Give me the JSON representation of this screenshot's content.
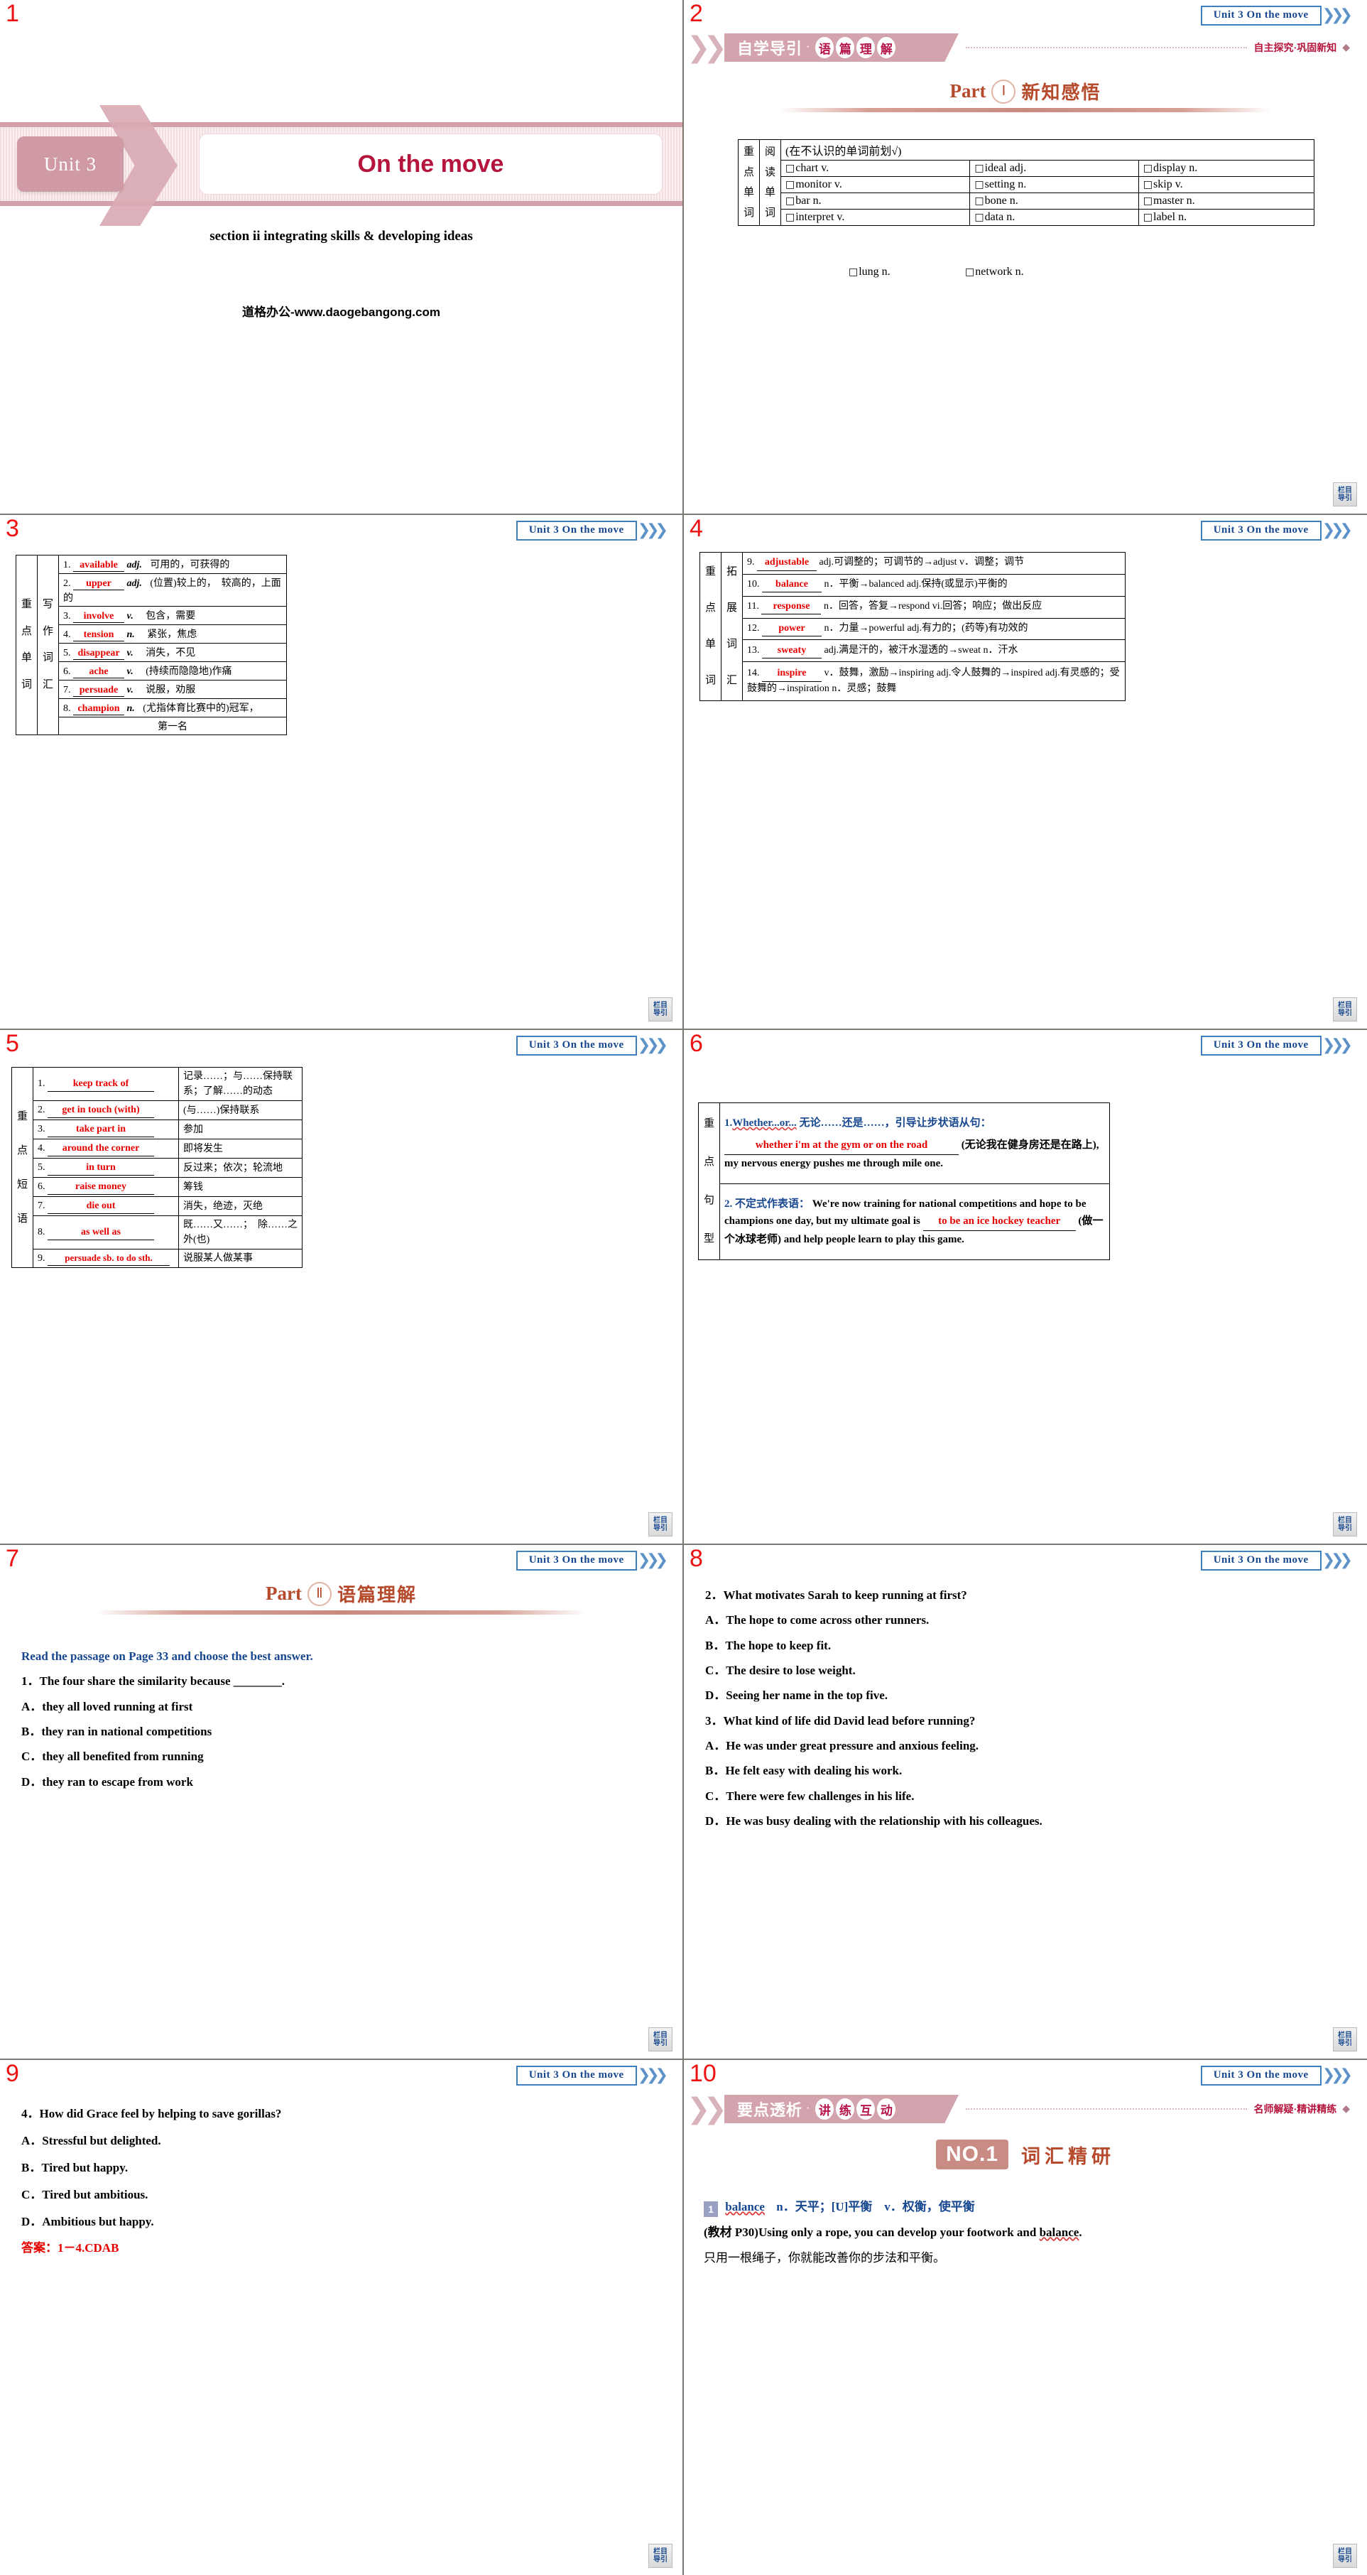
{
  "common": {
    "unit_banner": "Unit 3   On the move",
    "nav_button_line1": "栏目",
    "nav_button_line2": "导引",
    "accent_red": "#e60000",
    "accent_blue": "#16478f",
    "accent_brown": "#b64a2c",
    "accent_pink": "#d3a4ad"
  },
  "slides": [
    {
      "num": "1"
    },
    {
      "num": "2"
    },
    {
      "num": "3"
    },
    {
      "num": "4"
    },
    {
      "num": "5"
    },
    {
      "num": "6"
    },
    {
      "num": "7"
    },
    {
      "num": "8"
    },
    {
      "num": "9"
    },
    {
      "num": "10"
    }
  ],
  "slide1": {
    "unit_label": "Unit 3",
    "title": "On the move",
    "subtitle": "section ii integrating skills & developing ideas",
    "site": "道格办公-www.daogebangong.com"
  },
  "slide2": {
    "ribbon_left": "自学导引",
    "ribbon_dot": "·",
    "ribbon_circles": [
      "语",
      "篇",
      "理",
      "解"
    ],
    "ribbon_right": "自主探究·巩固新知",
    "part_word": "Part",
    "part_number": "Ⅰ",
    "part_cn": "新知感悟",
    "table": {
      "side1": [
        "重",
        "点",
        "单",
        "词"
      ],
      "side2": [
        "阅",
        "读",
        "单",
        "词"
      ],
      "hint": "(在不认识的单词前划√)",
      "rows": [
        [
          "chart v.",
          "ideal adj.",
          "display n."
        ],
        [
          "monitor v.",
          "setting n.",
          "skip v."
        ],
        [
          "bar n.",
          "bone n.",
          "master n."
        ],
        [
          "interpret v.",
          "data n.",
          "label n."
        ],
        [
          "lung n.",
          "network n.",
          ""
        ]
      ]
    }
  },
  "slide3": {
    "side1": [
      "重",
      "点",
      "单",
      "词"
    ],
    "side2": [
      "写",
      "作",
      "词",
      "汇"
    ],
    "items": [
      {
        "no": "1.",
        "word": "available",
        "pos": "adj.",
        "cn": "可用的，可获得的"
      },
      {
        "no": "2.",
        "word": "upper",
        "pos": "adj.",
        "cn": "(位置)较上的，　较高的，上面的"
      },
      {
        "no": "3.",
        "word": "involve",
        "pos": "v.",
        "cn": "包含，需要"
      },
      {
        "no": "4.",
        "word": "tension",
        "pos": "n.",
        "cn": "紧张，焦虑"
      },
      {
        "no": "5.",
        "word": "disappear",
        "pos": "v.",
        "cn": "消失，不见"
      },
      {
        "no": "6.",
        "word": "ache",
        "pos": "v.",
        "cn": "(持续而隐隐地)作痛"
      },
      {
        "no": "7.",
        "word": "persuade",
        "pos": "v.",
        "cn": "说服，劝服"
      },
      {
        "no": "8.",
        "word": "champion",
        "pos": "n.",
        "cn": "(尤指体育比赛中的)冠军，"
      },
      {
        "no": "",
        "word": "",
        "pos": "",
        "cn": "第一名"
      }
    ]
  },
  "slide4": {
    "side1": [
      "重",
      "点",
      "单",
      "词"
    ],
    "side2": [
      "拓",
      "展",
      "词",
      "汇"
    ],
    "items": [
      {
        "no": "9.",
        "word": "adjustable",
        "rest": "adj.可调整的；可调节的→adjust v．调整；调节"
      },
      {
        "no": "10.",
        "word": "balance",
        "rest": "n．平衡→balanced adj.保持(或显示)平衡的"
      },
      {
        "no": "11.",
        "word": "response",
        "rest": "n．回答，答复→respond vi.回答；响应；做出反应"
      },
      {
        "no": "12.",
        "word": "power",
        "rest": "n．力量→powerful adj.有力的；(药等)有功效的"
      },
      {
        "no": "13.",
        "word": "sweaty",
        "rest": "adj.满是汗的，被汗水湿透的→sweat n．汗水"
      },
      {
        "no": "14.",
        "word": "inspire",
        "rest": "v．鼓舞，激励→inspiring adj.令人鼓舞的→inspired adj.有灵感的；受鼓舞的→inspiration n．灵感；鼓舞"
      }
    ]
  },
  "slide5": {
    "side": [
      "重",
      "点",
      "短",
      "语"
    ],
    "items": [
      {
        "no": "1.",
        "phrase": "keep track of",
        "cn": "记录……；与……保持联系；了解……的动态"
      },
      {
        "no": "2.",
        "phrase": "get in touch (with)",
        "cn": "(与……)保持联系"
      },
      {
        "no": "3.",
        "phrase": "take part in",
        "cn": "参加"
      },
      {
        "no": "4.",
        "phrase": "around the corner",
        "cn": "即将发生"
      },
      {
        "no": "5.",
        "phrase": "in turn",
        "cn": "反过来；依次；轮流地"
      },
      {
        "no": "6.",
        "phrase": "raise money",
        "cn": "筹钱"
      },
      {
        "no": "7.",
        "phrase": "die out",
        "cn": "消失，绝迹，灭绝"
      },
      {
        "no": "8.",
        "phrase": "as well as",
        "cn": "既……又……；　除……之外(也)"
      },
      {
        "no": "9.",
        "phrase": "persuade sb. to do sth.",
        "cn": "说服某人做某事"
      }
    ]
  },
  "slide6": {
    "side": [
      "重",
      "点",
      "句",
      "型"
    ],
    "item1": {
      "no": "1.",
      "head_en": "Whether...or...",
      "head_cn": "无论……还是……，引导让步状语从句：",
      "blank": "whether i'm at the gym or on the road",
      "tail": "(无论我在健身房还是在路上), my nervous energy pushes me through mile one."
    },
    "item2": {
      "no": "2.",
      "head_cn": "不定式作表语：",
      "sentence_pre": "We're now training for national competitions and hope to be champions one day, but my ultimate goal is ",
      "blank": "to be an ice hockey teacher",
      "tail": " (做一个冰球老师) and help people learn to play this game."
    }
  },
  "slide7": {
    "part_word": "Part",
    "part_number": "Ⅱ",
    "part_cn": "语篇理解",
    "instruction": "Read the passage on Page 33 and choose the best answer.",
    "question": "1．The four share the similarity because ________.",
    "options": [
      "A．they all loved running at first",
      "B．they ran in national competitions",
      "C．they all benefited from running",
      "D．they ran to escape from work"
    ]
  },
  "slide8": {
    "q2": "2．What motivates Sarah to keep running at first?",
    "q2_options": [
      "A．The hope to come across other runners.",
      "B．The hope to keep fit.",
      "C．The desire to lose weight.",
      "D．Seeing her name in the top five."
    ],
    "q3": "3．What kind of life did David lead before running?",
    "q3_options": [
      "A．He was under great pressure and anxious feeling.",
      "B．He felt easy with dealing his work.",
      "C．There were few challenges in his life.",
      "D．He was busy dealing with the relationship with his colleagues."
    ]
  },
  "slide9": {
    "q4": "4．How did Grace feel by helping to save gorillas?",
    "q4_options": [
      "A．Stressful but delighted.",
      "B．Tired but happy.",
      "C．Tired but ambitious.",
      "D．Ambitious but happy."
    ],
    "answer": "答案：1－4.CDAB"
  },
  "slide10": {
    "ribbon_left": "要点透析",
    "ribbon_dot": "·",
    "ribbon_circles": [
      "讲",
      "练",
      "互",
      "动"
    ],
    "ribbon_right": "名师解疑·精讲精练",
    "no_badge": "NO.1",
    "no_cn": "词汇精研",
    "entry_number": "1",
    "entry_word": "balance",
    "entry_def": "n．天平；[U]平衡　v．权衡，使平衡",
    "example_source": "(教材 P30)",
    "example_en_pre": "Using only a rope, you can develop your footwork and ",
    "example_en_word": "balance",
    "example_en_post": ".",
    "example_cn": "只用一根绳子，你就能改善你的步法和平衡。"
  }
}
